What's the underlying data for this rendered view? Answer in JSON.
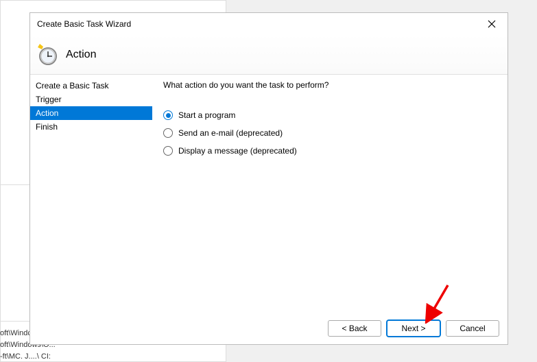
{
  "background": {
    "path1": "oft\\Windc",
    "path2": "oft\\Windows\\O...",
    "path3": "-ft\\MC. J....\\ CI:"
  },
  "dialog": {
    "title": "Create Basic Task Wizard",
    "header_title": "Action",
    "sidebar": {
      "items": [
        "Create a Basic Task",
        "Trigger",
        "Action",
        "Finish"
      ],
      "active_index": 2
    },
    "content": {
      "prompt": "What action do you want the task to perform?",
      "options": [
        {
          "label": "Start a program",
          "checked": true
        },
        {
          "label": "Send an e-mail (deprecated)",
          "checked": false
        },
        {
          "label": "Display a message (deprecated)",
          "checked": false
        }
      ]
    },
    "footer": {
      "back": "< Back",
      "next": "Next >",
      "cancel": "Cancel"
    }
  }
}
